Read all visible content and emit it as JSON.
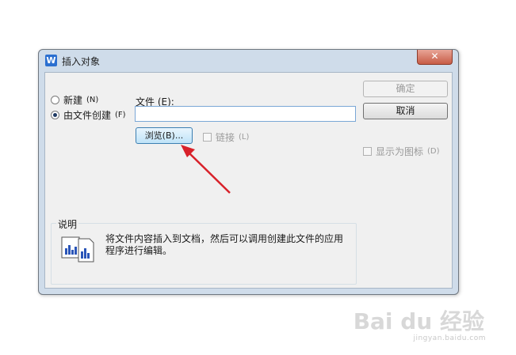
{
  "dialog": {
    "title": "插入对象",
    "close_label": "✕"
  },
  "radios": {
    "new_label": "新建",
    "new_key": "(N)",
    "from_file_label": "由文件创建",
    "from_file_key": "(F)",
    "selected": "from_file"
  },
  "file": {
    "label": "文件 (E):",
    "value": "",
    "browse_label": "浏览(B)...",
    "link_label": "链接",
    "link_key": "(L)"
  },
  "buttons": {
    "ok_label": "确定",
    "cancel_label": "取消"
  },
  "display_as_icon": {
    "label": "显示为图标",
    "key": "(D)"
  },
  "description": {
    "legend": "说明",
    "text": "将文件内容插入到文档，然后可以调用创建此文件的应用程序进行编辑。"
  },
  "watermark": {
    "brand": "Bai du 经验",
    "url": "jingyan.baidu.com"
  },
  "colors": {
    "title_bar": "#cfdcea",
    "close_button": "#c75c46",
    "browse_button": "#bfe3f8",
    "arrow": "#d8212a"
  },
  "icons": {
    "app": "wps-icon",
    "description": "document-chart-icon"
  }
}
